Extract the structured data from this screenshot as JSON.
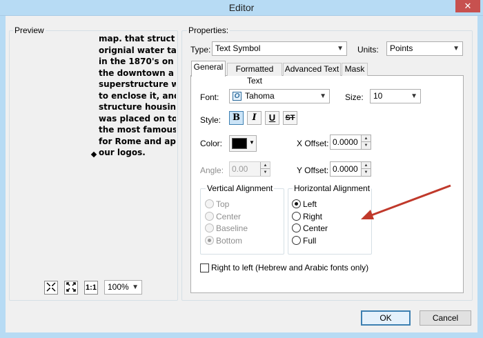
{
  "window": {
    "title": "Editor",
    "close_label": "✕"
  },
  "preview": {
    "legend": "Preview",
    "lines": [
      "map. that struct",
      "orignial water ta",
      "in the 1870's on",
      "the downtown a",
      "superstructure w",
      "to enclose it, and",
      "structure housin",
      "was placed on to",
      "the most famous",
      "for Rome and ap",
      "our logos."
    ],
    "zoom": "100%",
    "tools": {
      "actual_size_label": "1:1"
    }
  },
  "properties": {
    "legend": "Properties:",
    "type_label": "Type:",
    "type_value": "Text Symbol",
    "units_label": "Units:",
    "units_value": "Points"
  },
  "tabs": [
    "General",
    "Formatted Text",
    "Advanced Text",
    "Mask"
  ],
  "general": {
    "font_label": "Font:",
    "font_value": "Tahoma",
    "size_label": "Size:",
    "size_value": "10",
    "style_label": "Style:",
    "style_buttons": [
      "B",
      "I",
      "U",
      "ST"
    ],
    "color_label": "Color:",
    "color_value": "#000000",
    "x_offset_label": "X Offset:",
    "x_offset_value": "0.0000",
    "angle_label": "Angle:",
    "angle_value": "0.00",
    "y_offset_label": "Y Offset:",
    "y_offset_value": "0.0000",
    "vertical": {
      "legend": "Vertical Alignment",
      "options": [
        "Top",
        "Center",
        "Baseline",
        "Bottom"
      ],
      "selected": "Bottom"
    },
    "horizontal": {
      "legend": "Horizontal Alignment",
      "options": [
        "Left",
        "Right",
        "Center",
        "Full"
      ],
      "selected": "Left"
    },
    "rtl_label": "Right to left (Hebrew and Arabic fonts only)"
  },
  "buttons": {
    "ok": "OK",
    "cancel": "Cancel"
  },
  "colors": {
    "annotation_arrow": "#c0392b",
    "title_bar": "#b7dbf4",
    "close_button": "#c7514f"
  }
}
